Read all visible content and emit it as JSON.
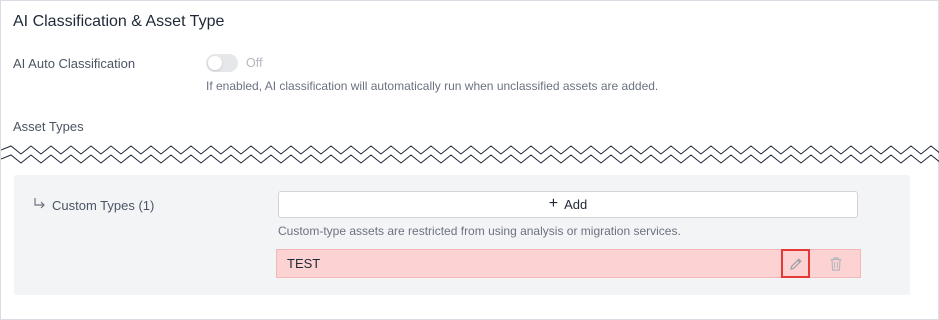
{
  "section": {
    "title": "AI Classification & Asset Type"
  },
  "auto_classification": {
    "label": "AI Auto Classification",
    "toggle_state": "Off",
    "help_text": "If enabled, AI classification will automatically run when unclassified assets are added."
  },
  "asset_types": {
    "label": "Asset Types",
    "custom_types_label": "Custom Types (1)",
    "add_label": "Add",
    "restriction_text": "Custom-type assets are restricted from using analysis or migration services.",
    "items": [
      {
        "name": "TEST",
        "highlighted": true
      }
    ]
  },
  "icons": {
    "branch": "branch-arrow-icon",
    "plus": "plus-icon",
    "edit": "pencil-icon",
    "delete": "trash-icon"
  },
  "colors": {
    "highlight_row": "#fdd2d2",
    "edit_focus_border": "#e53935"
  }
}
